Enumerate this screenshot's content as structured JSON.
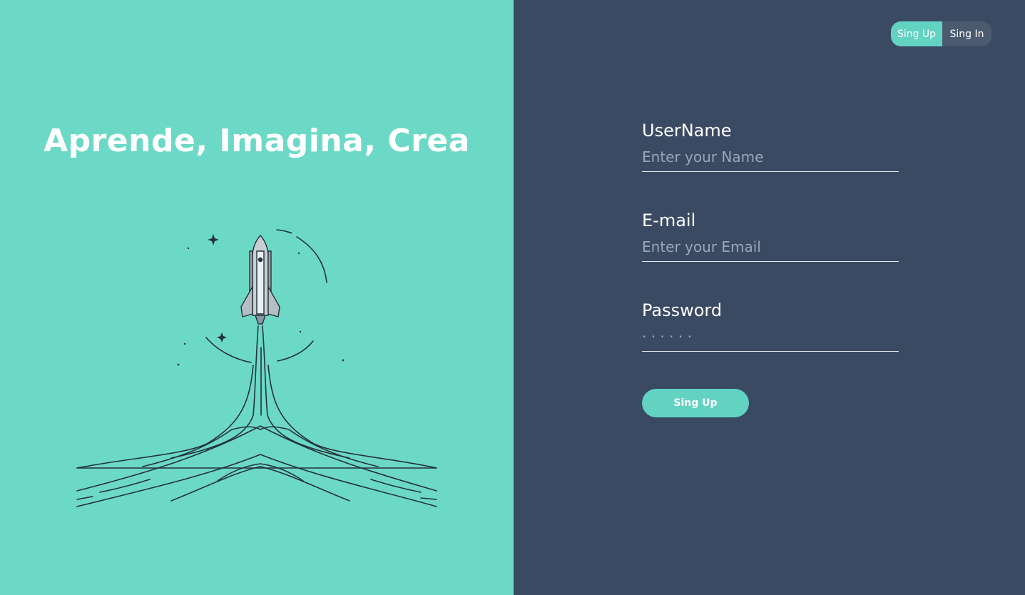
{
  "left": {
    "headline": "Aprende, Imagina, Crea",
    "illustration_icon": "rocket-launch-illustration"
  },
  "toggle": {
    "signup_label": "Sing Up",
    "signin_label": "Sing In",
    "active": "signup"
  },
  "form": {
    "username": {
      "label": "UserName",
      "placeholder": "Enter your Name",
      "value": ""
    },
    "email": {
      "label": "E-mail",
      "placeholder": "Enter your Email",
      "value": ""
    },
    "password": {
      "label": "Password",
      "placeholder": "· · · · · ·",
      "value": ""
    },
    "submit_label": "Sing Up"
  },
  "colors": {
    "left_bg": "#6cd9c7",
    "right_bg": "#3a4a63",
    "accent": "#62d2c1",
    "toggle_inactive": "#4c5a70"
  }
}
